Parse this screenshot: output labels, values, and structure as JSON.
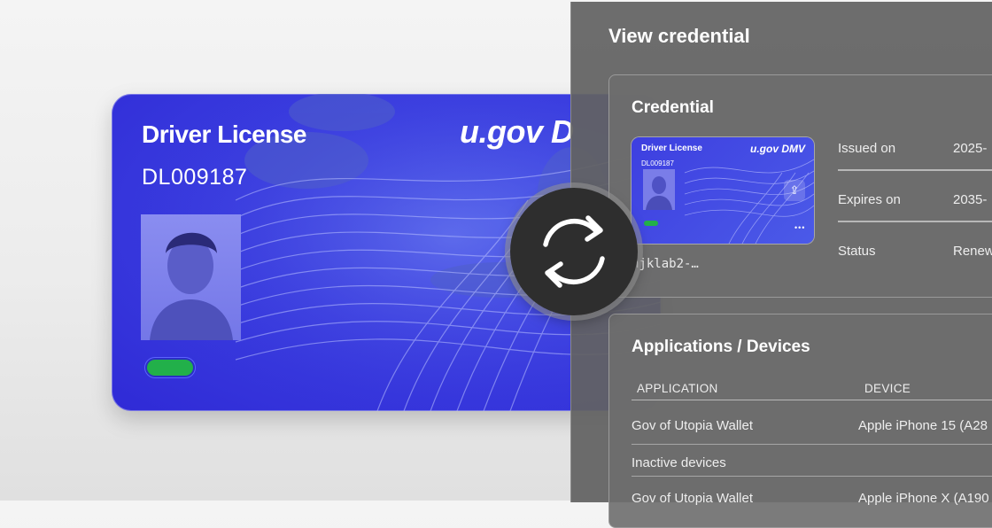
{
  "card": {
    "title": "Driver License",
    "number": "DL009187",
    "brand": "u.gov D",
    "status_color": "#22b04a",
    "background_color": "#3b3fe0"
  },
  "panel": {
    "title": "View credential",
    "credential": {
      "section_title": "Credential",
      "mini_card": {
        "title": "Driver License",
        "brand": "u.gov DMV",
        "number": "DL009187",
        "more": "•••"
      },
      "id_text": "njklab2-…",
      "fields": [
        {
          "label": "Issued on",
          "value": "2025-"
        },
        {
          "label": "Expires on",
          "value": "2035-"
        },
        {
          "label": "Status",
          "value": "Renew"
        }
      ]
    },
    "applications": {
      "section_title": "Applications / Devices",
      "headers": {
        "application": "APPLICATION",
        "device": "DEVICE"
      },
      "rows": [
        {
          "application": "Gov of Utopia Wallet",
          "device": "Apple iPhone 15 (A28"
        }
      ],
      "inactive_label": "Inactive devices",
      "inactive_rows": [
        {
          "application": "Gov of Utopia Wallet",
          "device": "Apple iPhone X (A190"
        }
      ]
    }
  },
  "icons": {
    "sync": "sync-icon",
    "share": "share-icon",
    "more": "more-icon"
  }
}
